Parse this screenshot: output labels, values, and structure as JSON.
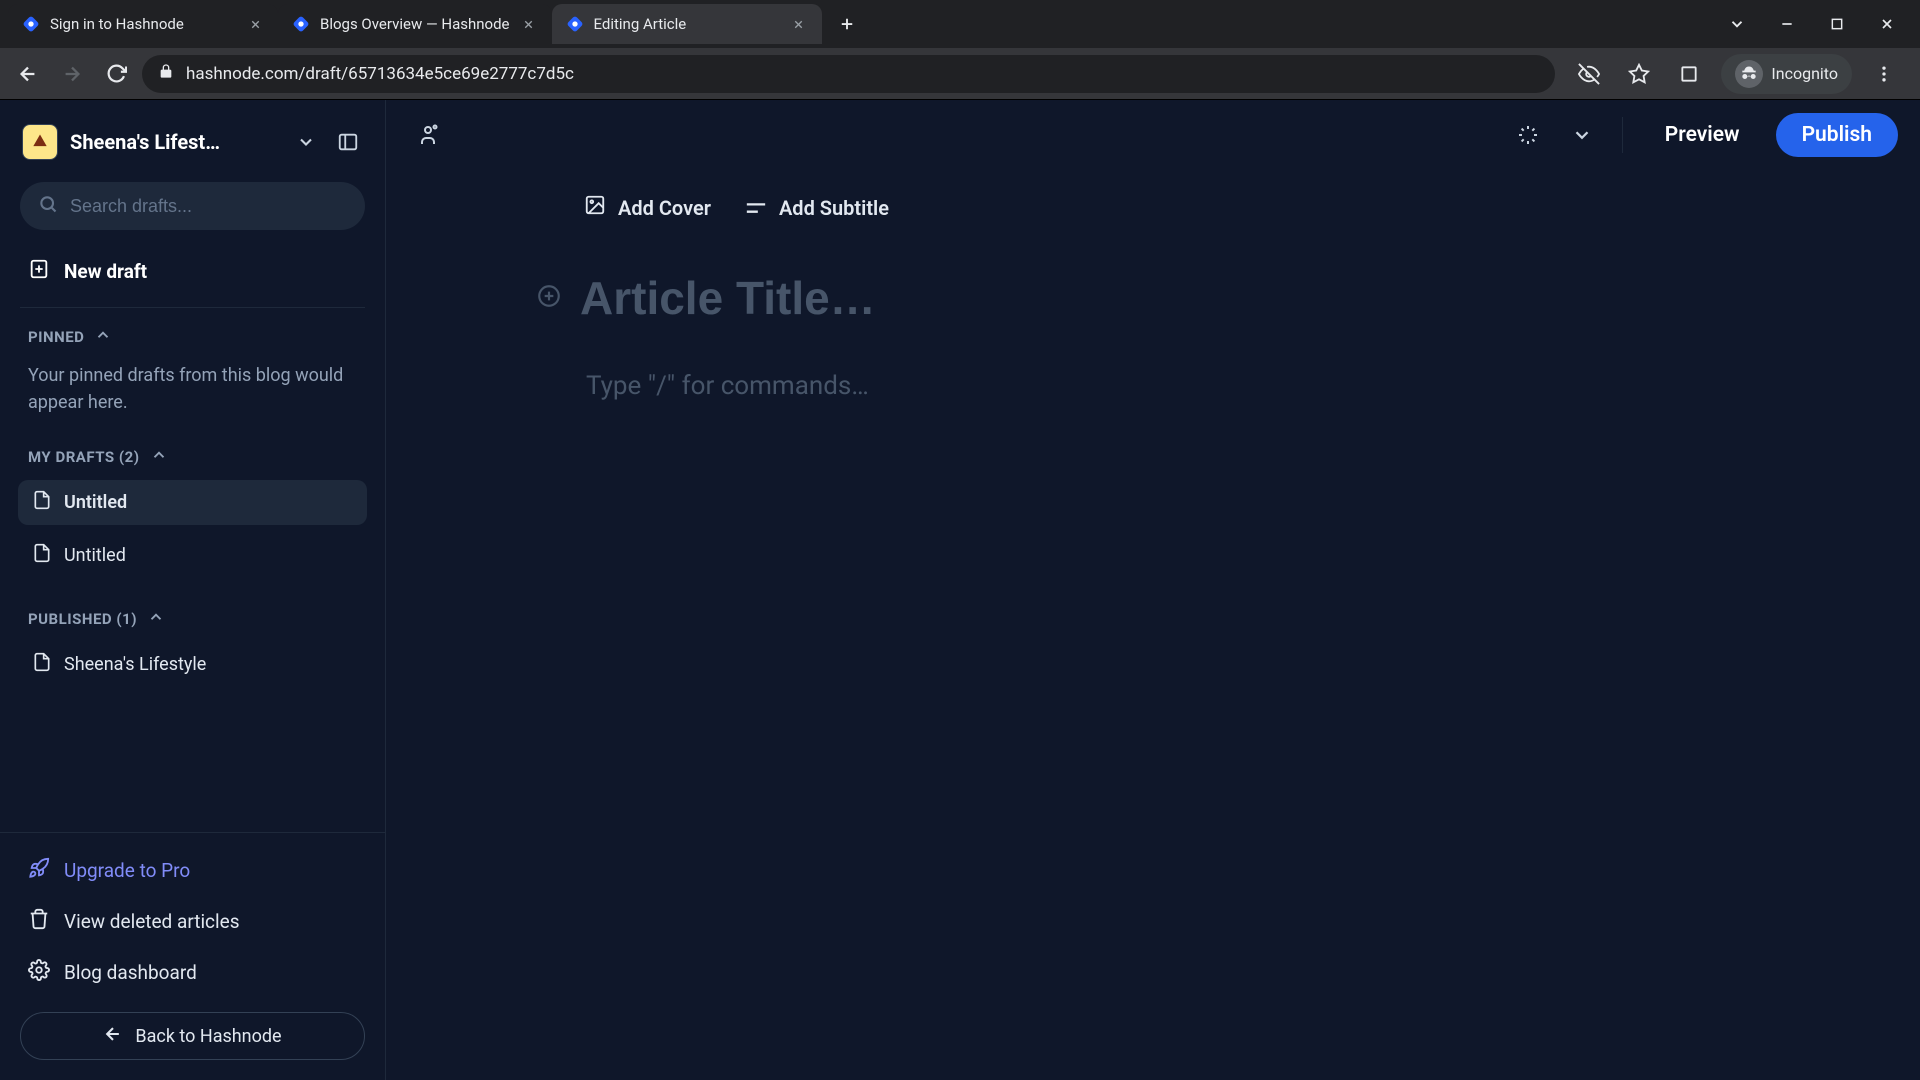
{
  "browser": {
    "tabs": [
      {
        "title": "Sign in to Hashnode"
      },
      {
        "title": "Blogs Overview — Hashnode"
      },
      {
        "title": "Editing Article"
      }
    ],
    "active_tab_index": 2,
    "url": "hashnode.com/draft/65713634e5ce69e2777c7d5c",
    "profile_label": "Incognito"
  },
  "sidebar": {
    "blog_name": "Sheena's Lifest…",
    "search_placeholder": "Search drafts...",
    "new_draft_label": "New draft",
    "pinned": {
      "header": "PINNED",
      "empty_text": "Your pinned drafts from this blog would appear here."
    },
    "my_drafts": {
      "header": "MY DRAFTS (2)",
      "items": [
        "Untitled",
        "Untitled"
      ],
      "active_index": 0
    },
    "published": {
      "header": "PUBLISHED (1)",
      "items": [
        "Sheena's Lifestyle"
      ]
    },
    "upgrade_label": "Upgrade to Pro",
    "deleted_label": "View deleted articles",
    "dashboard_label": "Blog dashboard",
    "back_label": "Back to Hashnode"
  },
  "topbar": {
    "preview_label": "Preview",
    "publish_label": "Publish"
  },
  "editor": {
    "add_cover_label": "Add Cover",
    "add_subtitle_label": "Add Subtitle",
    "title_placeholder": "Article Title…",
    "body_placeholder": "Type \"/\" for commands…"
  }
}
